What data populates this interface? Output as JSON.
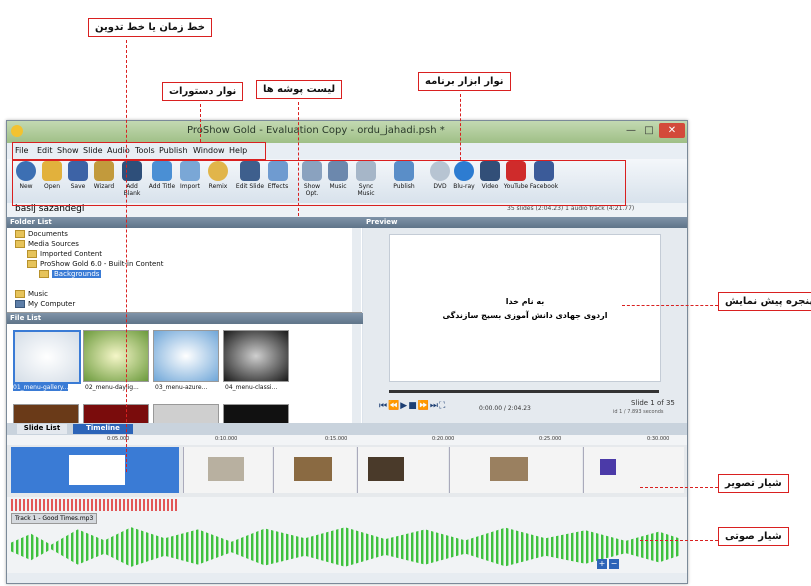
{
  "callouts": {
    "timeline": "خط زمان یا خط تدوین",
    "menubar": "نوار دستورات",
    "folders": "لیست پوشه ها",
    "toolbar": "نوار ابزار برنامه",
    "preview": "پنجره پیش نمایش",
    "slide_track": "شیار تصویر",
    "audio_track": "شیار صوتی"
  },
  "window": {
    "title": "ProShow Gold - Evaluation Copy - ordu_jahadi.psh *",
    "menu": [
      "File",
      "Edit",
      "Show",
      "Slide",
      "Audio",
      "Tools",
      "Publish",
      "Window",
      "Help"
    ],
    "toolbar": [
      "New",
      "Open",
      "Save",
      "Wizard",
      "Add Blank",
      "Add Title",
      "Import",
      "Remix",
      "Edit Slide",
      "Effects",
      "Show Opt.",
      "Music",
      "Sync Music",
      "Publish",
      "DVD",
      "Blu-ray",
      "Video",
      "YouTube",
      "Facebook"
    ],
    "show_name": "basij sazandegi",
    "show_info": "35 slides (2:04.23)  1 audio track (4:21.77)"
  },
  "folder_list": {
    "header": "Folder List",
    "items": [
      "Documents",
      "Media Sources",
      "Imported Content",
      "ProShow Gold 6.0 - Built-in Content",
      "Backgrounds",
      "Music",
      "My Computer"
    ]
  },
  "file_list": {
    "header": "File List",
    "items": [
      "01_menu-gallery...",
      "02_menu-daylig...",
      "03_menu-azure...",
      "04_menu-classi..."
    ]
  },
  "preview": {
    "header": "Preview",
    "line1": "به نام خدا",
    "line2": "اردوی جهادی دانش آموزی بسیج سازندگی",
    "time": "0:00.00 / 2:04.23",
    "slide_of": "Slide 1 of 35",
    "slide_secs": "id 1 / 7.893 seconds"
  },
  "tabs": [
    "Slide List",
    "Timeline"
  ],
  "ruler": [
    "0:05.000",
    "0:10.000",
    "0:15.000",
    "0:20.000",
    "0:25.000",
    "0:30.000"
  ],
  "audio_track_label": "Track 1 - Good Times.mp3",
  "colors": {
    "accent": "#d92020",
    "audio": "#3fbf3f",
    "selection": "#3a7bd5"
  }
}
